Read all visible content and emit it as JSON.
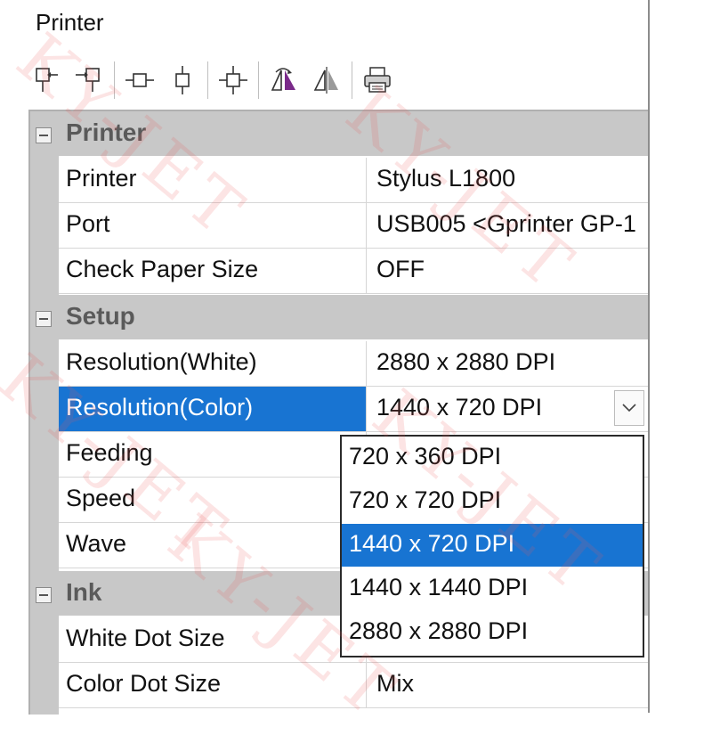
{
  "title": "Printer",
  "toolbar": {
    "icons": [
      "align-left-icon",
      "align-right-icon",
      "center-horizontal-icon",
      "center-vertical-icon",
      "center-both-icon",
      "mirror-flip-icon",
      "mirror-icon",
      "print-icon"
    ]
  },
  "categories": [
    {
      "label": "Printer"
    },
    {
      "label": "Setup"
    },
    {
      "label": "Ink"
    }
  ],
  "rows": [
    {
      "name": "Printer",
      "value": "Stylus L1800"
    },
    {
      "name": "Port",
      "value": "USB005   <Gprinter GP-1"
    },
    {
      "name": "Check Paper Size",
      "value": "OFF"
    },
    {
      "name": "Resolution(White)",
      "value": "2880 x 2880 DPI"
    },
    {
      "name": "Resolution(Color)",
      "value": "1440 x 720 DPI"
    },
    {
      "name": "Feeding",
      "value": ""
    },
    {
      "name": "Speed",
      "value": ""
    },
    {
      "name": "Wave",
      "value": ""
    },
    {
      "name": "White Dot Size",
      "value": ""
    },
    {
      "name": "Color Dot Size",
      "value": "Mix"
    }
  ],
  "dropdown": {
    "options": [
      "720 x 360 DPI",
      "720 x 720 DPI",
      "1440 x 720 DPI",
      "1440 x 1440 DPI",
      "2880 x 2880 DPI"
    ],
    "selected": "1440 x 720 DPI"
  },
  "watermark": {
    "text": "KY-JET"
  },
  "colors": {
    "selection": "#1874d2",
    "category_bg": "#c8c8c8",
    "watermark": "#eb5a5a"
  }
}
